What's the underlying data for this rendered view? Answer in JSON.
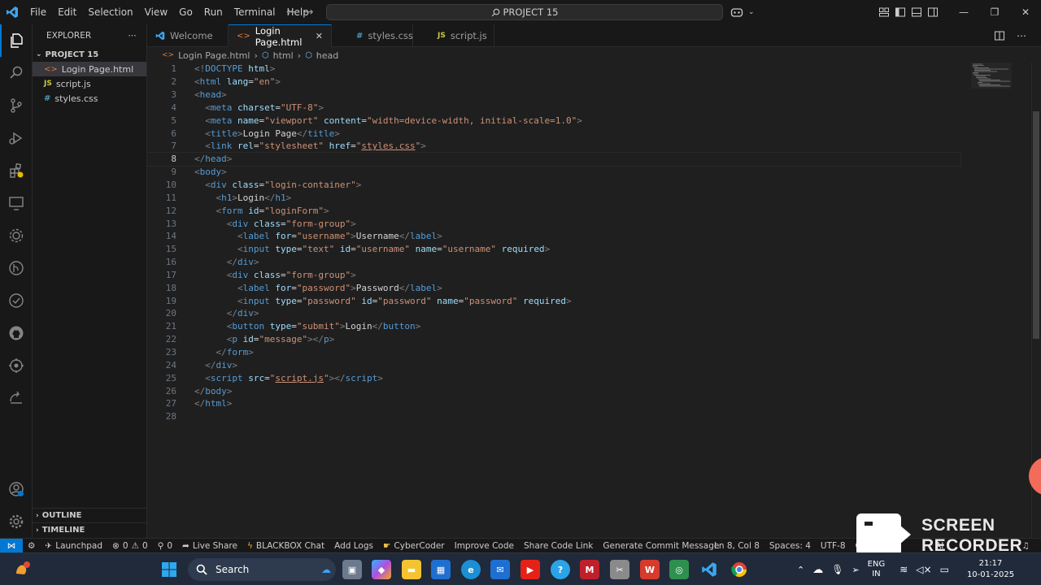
{
  "menu": [
    "File",
    "Edit",
    "Selection",
    "View",
    "Go",
    "Run",
    "Terminal",
    "Help"
  ],
  "command_center": {
    "label": "PROJECT 15"
  },
  "sidebar": {
    "title": "EXPLORER",
    "project": "PROJECT 15",
    "files": [
      {
        "name": "Login Page.html",
        "icon": "html-file-icon",
        "selected": true
      },
      {
        "name": "script.js",
        "icon": "js-file-icon",
        "selected": false
      },
      {
        "name": "styles.css",
        "icon": "css-file-icon",
        "selected": false
      }
    ],
    "outline": "OUTLINE",
    "timeline": "TIMELINE"
  },
  "tabs": [
    {
      "label": "Welcome",
      "icon": "vscode-icon",
      "active": false
    },
    {
      "label": "Login Page.html",
      "icon": "html-file-icon",
      "active": true
    },
    {
      "label": "styles.css",
      "icon": "css-file-icon",
      "active": false
    },
    {
      "label": "script.js",
      "icon": "js-file-icon",
      "active": false
    }
  ],
  "breadcrumb": [
    "Login Page.html",
    "html",
    "head"
  ],
  "editor": {
    "current_line": 8,
    "lines": [
      [
        [
          "br",
          "<!"
        ],
        [
          "t",
          "DOCTYPE"
        ],
        [
          "tx",
          " "
        ],
        [
          "at",
          "html"
        ],
        [
          "br",
          ">"
        ]
      ],
      [
        [
          "br",
          "<"
        ],
        [
          "t",
          "html"
        ],
        [
          "tx",
          " "
        ],
        [
          "at",
          "lang"
        ],
        [
          "tx",
          "="
        ],
        [
          "st",
          "\"en\""
        ],
        [
          "br",
          ">"
        ]
      ],
      [
        [
          "br",
          "<"
        ],
        [
          "t",
          "head"
        ],
        [
          "br",
          ">"
        ]
      ],
      [
        [
          "tx",
          "  "
        ],
        [
          "br",
          "<"
        ],
        [
          "t",
          "meta"
        ],
        [
          "tx",
          " "
        ],
        [
          "at",
          "charset"
        ],
        [
          "tx",
          "="
        ],
        [
          "st",
          "\"UTF-8\""
        ],
        [
          "br",
          ">"
        ]
      ],
      [
        [
          "tx",
          "  "
        ],
        [
          "br",
          "<"
        ],
        [
          "t",
          "meta"
        ],
        [
          "tx",
          " "
        ],
        [
          "at",
          "name"
        ],
        [
          "tx",
          "="
        ],
        [
          "st",
          "\"viewport\""
        ],
        [
          "tx",
          " "
        ],
        [
          "at",
          "content"
        ],
        [
          "tx",
          "="
        ],
        [
          "st",
          "\"width=device-width, initial-scale=1.0\""
        ],
        [
          "br",
          ">"
        ]
      ],
      [
        [
          "tx",
          "  "
        ],
        [
          "br",
          "<"
        ],
        [
          "t",
          "title"
        ],
        [
          "br",
          ">"
        ],
        [
          "tx",
          "Login Page"
        ],
        [
          "br",
          "</"
        ],
        [
          "t",
          "title"
        ],
        [
          "br",
          ">"
        ]
      ],
      [
        [
          "tx",
          "  "
        ],
        [
          "br",
          "<"
        ],
        [
          "t",
          "link"
        ],
        [
          "tx",
          " "
        ],
        [
          "at",
          "rel"
        ],
        [
          "tx",
          "="
        ],
        [
          "st",
          "\"stylesheet\""
        ],
        [
          "tx",
          " "
        ],
        [
          "at",
          "href"
        ],
        [
          "tx",
          "="
        ],
        [
          "st",
          "\""
        ],
        [
          "stu",
          "styles.css"
        ],
        [
          "st",
          "\""
        ],
        [
          "br",
          ">"
        ]
      ],
      [
        [
          "br",
          "</"
        ],
        [
          "t",
          "head"
        ],
        [
          "br",
          ">"
        ]
      ],
      [
        [
          "br",
          "<"
        ],
        [
          "t",
          "body"
        ],
        [
          "br",
          ">"
        ]
      ],
      [
        [
          "tx",
          "  "
        ],
        [
          "br",
          "<"
        ],
        [
          "t",
          "div"
        ],
        [
          "tx",
          " "
        ],
        [
          "at",
          "class"
        ],
        [
          "tx",
          "="
        ],
        [
          "st",
          "\"login-container\""
        ],
        [
          "br",
          ">"
        ]
      ],
      [
        [
          "tx",
          "    "
        ],
        [
          "br",
          "<"
        ],
        [
          "t",
          "h1"
        ],
        [
          "br",
          ">"
        ],
        [
          "tx",
          "Login"
        ],
        [
          "br",
          "</"
        ],
        [
          "t",
          "h1"
        ],
        [
          "br",
          ">"
        ]
      ],
      [
        [
          "tx",
          "    "
        ],
        [
          "br",
          "<"
        ],
        [
          "t",
          "form"
        ],
        [
          "tx",
          " "
        ],
        [
          "at",
          "id"
        ],
        [
          "tx",
          "="
        ],
        [
          "st",
          "\"loginForm\""
        ],
        [
          "br",
          ">"
        ]
      ],
      [
        [
          "tx",
          "      "
        ],
        [
          "br",
          "<"
        ],
        [
          "t",
          "div"
        ],
        [
          "tx",
          " "
        ],
        [
          "at",
          "class"
        ],
        [
          "tx",
          "="
        ],
        [
          "st",
          "\"form-group\""
        ],
        [
          "br",
          ">"
        ]
      ],
      [
        [
          "tx",
          "        "
        ],
        [
          "br",
          "<"
        ],
        [
          "t",
          "label"
        ],
        [
          "tx",
          " "
        ],
        [
          "at",
          "for"
        ],
        [
          "tx",
          "="
        ],
        [
          "st",
          "\"username\""
        ],
        [
          "br",
          ">"
        ],
        [
          "tx",
          "Username"
        ],
        [
          "br",
          "</"
        ],
        [
          "t",
          "label"
        ],
        [
          "br",
          ">"
        ]
      ],
      [
        [
          "tx",
          "        "
        ],
        [
          "br",
          "<"
        ],
        [
          "t",
          "input"
        ],
        [
          "tx",
          " "
        ],
        [
          "at",
          "type"
        ],
        [
          "tx",
          "="
        ],
        [
          "st",
          "\"text\""
        ],
        [
          "tx",
          " "
        ],
        [
          "at",
          "id"
        ],
        [
          "tx",
          "="
        ],
        [
          "st",
          "\"username\""
        ],
        [
          "tx",
          " "
        ],
        [
          "at",
          "name"
        ],
        [
          "tx",
          "="
        ],
        [
          "st",
          "\"username\""
        ],
        [
          "tx",
          " "
        ],
        [
          "at",
          "required"
        ],
        [
          "br",
          ">"
        ]
      ],
      [
        [
          "tx",
          "      "
        ],
        [
          "br",
          "</"
        ],
        [
          "t",
          "div"
        ],
        [
          "br",
          ">"
        ]
      ],
      [
        [
          "tx",
          "      "
        ],
        [
          "br",
          "<"
        ],
        [
          "t",
          "div"
        ],
        [
          "tx",
          " "
        ],
        [
          "at",
          "class"
        ],
        [
          "tx",
          "="
        ],
        [
          "st",
          "\"form-group\""
        ],
        [
          "br",
          ">"
        ]
      ],
      [
        [
          "tx",
          "        "
        ],
        [
          "br",
          "<"
        ],
        [
          "t",
          "label"
        ],
        [
          "tx",
          " "
        ],
        [
          "at",
          "for"
        ],
        [
          "tx",
          "="
        ],
        [
          "st",
          "\"password\""
        ],
        [
          "br",
          ">"
        ],
        [
          "tx",
          "Password"
        ],
        [
          "br",
          "</"
        ],
        [
          "t",
          "label"
        ],
        [
          "br",
          ">"
        ]
      ],
      [
        [
          "tx",
          "        "
        ],
        [
          "br",
          "<"
        ],
        [
          "t",
          "input"
        ],
        [
          "tx",
          " "
        ],
        [
          "at",
          "type"
        ],
        [
          "tx",
          "="
        ],
        [
          "st",
          "\"password\""
        ],
        [
          "tx",
          " "
        ],
        [
          "at",
          "id"
        ],
        [
          "tx",
          "="
        ],
        [
          "st",
          "\"password\""
        ],
        [
          "tx",
          " "
        ],
        [
          "at",
          "name"
        ],
        [
          "tx",
          "="
        ],
        [
          "st",
          "\"password\""
        ],
        [
          "tx",
          " "
        ],
        [
          "at",
          "required"
        ],
        [
          "br",
          ">"
        ]
      ],
      [
        [
          "tx",
          "      "
        ],
        [
          "br",
          "</"
        ],
        [
          "t",
          "div"
        ],
        [
          "br",
          ">"
        ]
      ],
      [
        [
          "tx",
          "      "
        ],
        [
          "br",
          "<"
        ],
        [
          "t",
          "button"
        ],
        [
          "tx",
          " "
        ],
        [
          "at",
          "type"
        ],
        [
          "tx",
          "="
        ],
        [
          "st",
          "\"submit\""
        ],
        [
          "br",
          ">"
        ],
        [
          "tx",
          "Login"
        ],
        [
          "br",
          "</"
        ],
        [
          "t",
          "button"
        ],
        [
          "br",
          ">"
        ]
      ],
      [
        [
          "tx",
          "      "
        ],
        [
          "br",
          "<"
        ],
        [
          "t",
          "p"
        ],
        [
          "tx",
          " "
        ],
        [
          "at",
          "id"
        ],
        [
          "tx",
          "="
        ],
        [
          "st",
          "\"message\""
        ],
        [
          "br",
          "></"
        ],
        [
          "t",
          "p"
        ],
        [
          "br",
          ">"
        ]
      ],
      [
        [
          "tx",
          "    "
        ],
        [
          "br",
          "</"
        ],
        [
          "t",
          "form"
        ],
        [
          "br",
          ">"
        ]
      ],
      [
        [
          "tx",
          "  "
        ],
        [
          "br",
          "</"
        ],
        [
          "t",
          "div"
        ],
        [
          "br",
          ">"
        ]
      ],
      [
        [
          "tx",
          "  "
        ],
        [
          "br",
          "<"
        ],
        [
          "t",
          "script"
        ],
        [
          "tx",
          " "
        ],
        [
          "at",
          "src"
        ],
        [
          "tx",
          "="
        ],
        [
          "st",
          "\""
        ],
        [
          "stu",
          "script.js"
        ],
        [
          "st",
          "\""
        ],
        [
          "br",
          "></"
        ],
        [
          "t",
          "script"
        ],
        [
          "br",
          ">"
        ]
      ],
      [
        [
          "br",
          "</"
        ],
        [
          "t",
          "body"
        ],
        [
          "br",
          ">"
        ]
      ],
      [
        [
          "br",
          "</"
        ],
        [
          "t",
          "html"
        ],
        [
          "br",
          ">"
        ]
      ],
      []
    ]
  },
  "statusbar": {
    "launchpad": "Launchpad",
    "problems": "0",
    "warnings": "0",
    "ports": "0",
    "live_share": "Live Share",
    "blackbox": "BLACKBOX Chat",
    "add_logs": "Add Logs",
    "cybercoder": "CyberCoder",
    "improve_code": "Improve Code",
    "share_code": "Share Code Link",
    "commit_msg": "Generate Commit Message",
    "position": "Ln 8, Col 8",
    "spaces": "Spaces: 4",
    "encoding": "UTF-8",
    "eol": "CRLF",
    "ai": "AI"
  },
  "watermark": {
    "line1": "SCREEN",
    "line2": "RECORDER"
  },
  "taskbar": {
    "search": "Search",
    "lang1": "ENG",
    "lang2": "IN",
    "time": "21:17",
    "date": "10-01-2025"
  },
  "colors": {
    "accent": "#0078d4",
    "background": "#1f1f1f",
    "panel": "#181818"
  }
}
